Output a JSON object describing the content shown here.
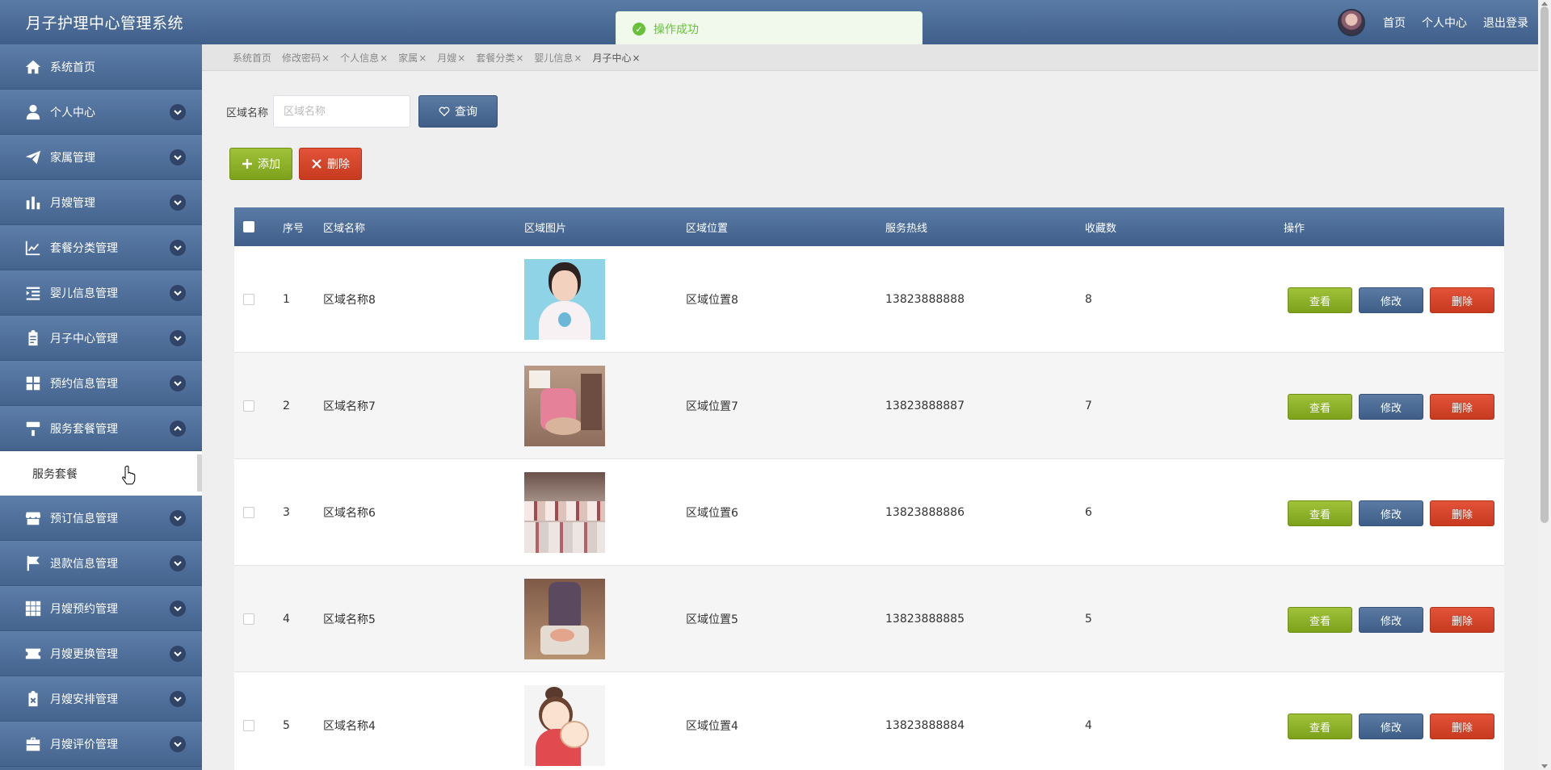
{
  "header": {
    "title": "月子护理中心管理系统",
    "links": [
      "首页",
      "个人中心",
      "退出登录"
    ]
  },
  "toast": {
    "message": "操作成功"
  },
  "sidebar": {
    "items": [
      {
        "label": "系统首页",
        "icon": "home-icon",
        "chevron": false
      },
      {
        "label": "个人中心",
        "icon": "user-icon",
        "chevron": "down"
      },
      {
        "label": "家属管理",
        "icon": "paper-plane-icon",
        "chevron": "down"
      },
      {
        "label": "月嫂管理",
        "icon": "bar-chart-icon",
        "chevron": "down"
      },
      {
        "label": "套餐分类管理",
        "icon": "line-chart-icon",
        "chevron": "down"
      },
      {
        "label": "婴儿信息管理",
        "icon": "list-indent-icon",
        "chevron": "down"
      },
      {
        "label": "月子中心管理",
        "icon": "clipboard-icon",
        "chevron": "down"
      },
      {
        "label": "预约信息管理",
        "icon": "grid-four-icon",
        "chevron": "down"
      },
      {
        "label": "服务套餐管理",
        "icon": "paint-roller-icon",
        "chevron": "up"
      }
    ],
    "submenu": {
      "label": "服务套餐"
    },
    "items_after": [
      {
        "label": "预订信息管理",
        "icon": "shop-icon",
        "chevron": "down"
      },
      {
        "label": "退款信息管理",
        "icon": "flag-icon",
        "chevron": "down"
      },
      {
        "label": "月嫂预约管理",
        "icon": "grid-nine-icon",
        "chevron": "down"
      },
      {
        "label": "月嫂更换管理",
        "icon": "ticket-icon",
        "chevron": "down"
      },
      {
        "label": "月嫂安排管理",
        "icon": "clipboard-x-icon",
        "chevron": "down"
      },
      {
        "label": "月嫂评价管理",
        "icon": "briefcase-icon",
        "chevron": "down"
      }
    ]
  },
  "tabs": [
    {
      "label": "系统首页",
      "closable": false
    },
    {
      "label": "修改密码",
      "closable": true
    },
    {
      "label": "个人信息",
      "closable": true
    },
    {
      "label": "家属",
      "closable": true
    },
    {
      "label": "月嫂",
      "closable": true
    },
    {
      "label": "套餐分类",
      "closable": true
    },
    {
      "label": "婴儿信息",
      "closable": true
    },
    {
      "label": "月子中心",
      "closable": true,
      "active": true
    }
  ],
  "search": {
    "label": "区域名称",
    "placeholder": "区域名称",
    "value": "",
    "button": "查询"
  },
  "actions": {
    "add": "添加",
    "delete": "删除"
  },
  "table": {
    "headers": [
      "序号",
      "区域名称",
      "区域图片",
      "区域位置",
      "服务热线",
      "收藏数",
      "操作"
    ],
    "rows": [
      {
        "no": "1",
        "name": "区域名称8",
        "location": "区域位置8",
        "phone": "13823888888",
        "favorites": "8",
        "image": "woman-portrait"
      },
      {
        "no": "2",
        "name": "区域名称7",
        "location": "区域位置7",
        "phone": "13823888887",
        "favorites": "7",
        "image": "baby-care"
      },
      {
        "no": "3",
        "name": "区域名称6",
        "location": "区域位置6",
        "phone": "13823888886",
        "favorites": "6",
        "image": "training-room"
      },
      {
        "no": "4",
        "name": "区域名称5",
        "location": "区域位置5",
        "phone": "13823888885",
        "favorites": "5",
        "image": "nurse-bath"
      },
      {
        "no": "5",
        "name": "区域名称4",
        "location": "区域位置4",
        "phone": "13823888884",
        "favorites": "4",
        "image": "cartoon-mother"
      }
    ],
    "row_actions": {
      "view": "查看",
      "edit": "修改",
      "delete": "删除"
    }
  }
}
